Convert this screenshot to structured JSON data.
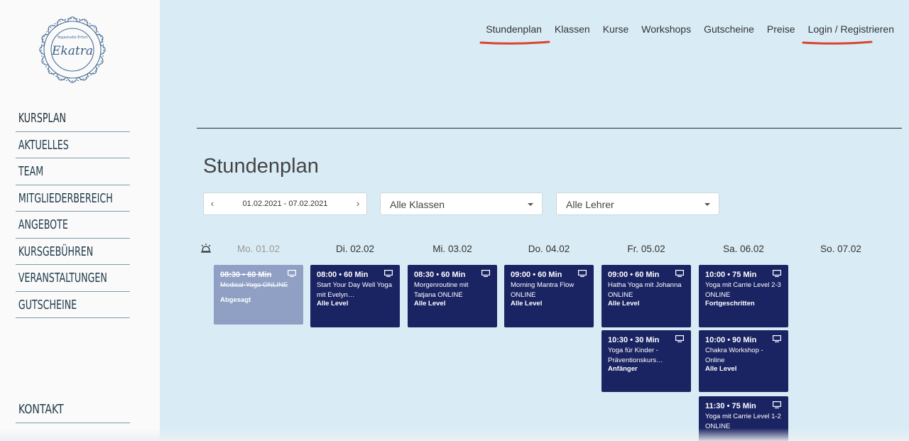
{
  "logo": {
    "name": "Ekatra",
    "ring_text": "Yogastudio Erfurt"
  },
  "sidebar": {
    "items": [
      {
        "label": "KURSPLAN"
      },
      {
        "label": "AKTUELLES"
      },
      {
        "label": "TEAM"
      },
      {
        "label": "MITGLIEDERBEREICH"
      },
      {
        "label": "ANGEBOTE"
      },
      {
        "label": "KURSGEBÜHREN"
      },
      {
        "label": "VERANSTALTUNGEN"
      },
      {
        "label": "GUTSCHEINE"
      }
    ],
    "contact_label": "KONTAKT"
  },
  "topnav": {
    "items": [
      {
        "label": "Stundenplan",
        "underline": true
      },
      {
        "label": "Klassen",
        "underline": false
      },
      {
        "label": "Kurse",
        "underline": false
      },
      {
        "label": "Workshops",
        "underline": false
      },
      {
        "label": "Gutscheine",
        "underline": false
      },
      {
        "label": "Preise",
        "underline": false
      },
      {
        "label": "Login / Registrieren",
        "underline": true
      }
    ],
    "underline_color": "#d9442f"
  },
  "page_title": "Stundenplan",
  "filters": {
    "date_range": "01.02.2021 - 07.02.2021",
    "class_select": "Alle Klassen",
    "teacher_select": "Alle Lehrer"
  },
  "schedule": {
    "days": [
      {
        "label": "Mo. 01.02",
        "past": true
      },
      {
        "label": "Di. 02.02",
        "past": false
      },
      {
        "label": "Mi. 03.02",
        "past": false
      },
      {
        "label": "Do. 04.02",
        "past": false
      },
      {
        "label": "Fr. 05.02",
        "past": false
      },
      {
        "label": "Sa. 06.02",
        "past": false
      },
      {
        "label": "So. 07.02",
        "past": false
      }
    ],
    "classes": [
      {
        "day": 0,
        "slot": 0,
        "time": "08:30 • 60 Min",
        "name": "Medical-Yoga ONLINE",
        "level": "",
        "status": "Abgesagt",
        "cancelled": true
      },
      {
        "day": 1,
        "slot": 0,
        "time": "08:00 • 60 Min",
        "name": "Start Your Day Well Yoga mit Evelyn…",
        "level": "Alle Level",
        "status": "",
        "cancelled": false
      },
      {
        "day": 2,
        "slot": 0,
        "time": "08:30 • 60 Min",
        "name": "Morgenroutine mit Tatjana ONLINE",
        "level": "Alle Level",
        "status": "",
        "cancelled": false
      },
      {
        "day": 3,
        "slot": 0,
        "time": "09:00 • 60 Min",
        "name": "Morning Mantra Flow ONLINE",
        "level": "Alle Level",
        "status": "",
        "cancelled": false
      },
      {
        "day": 4,
        "slot": 0,
        "time": "09:00 • 60 Min",
        "name": "Hatha Yoga mit Johanna ONLINE",
        "level": "Alle Level",
        "status": "",
        "cancelled": false
      },
      {
        "day": 5,
        "slot": 0,
        "time": "10:00 • 75 Min",
        "name": "Yoga mit Carrie Level 2-3 ONLINE",
        "level": "Fortgeschritten",
        "status": "",
        "cancelled": false
      },
      {
        "day": 4,
        "slot": 1,
        "time": "10:30 • 30 Min",
        "name": "Yoga für Kinder - Präventionskurs…",
        "level": "Anfänger",
        "status": "",
        "cancelled": false
      },
      {
        "day": 5,
        "slot": 1,
        "time": "10:00 • 90 Min",
        "name": "Chakra Workshop - Online",
        "level": "Alle Level",
        "status": "",
        "cancelled": false
      },
      {
        "day": 5,
        "slot": 2,
        "time": "11:30 • 75 Min",
        "name": "Yoga mit Carrie Level 1-2 ONLINE",
        "level": "",
        "status": "",
        "cancelled": false
      }
    ]
  },
  "colors": {
    "card": "#1b2462",
    "card_cancelled": "#8fa0c4",
    "background": "#d9ecf5",
    "sidebar": "#fafafa"
  }
}
